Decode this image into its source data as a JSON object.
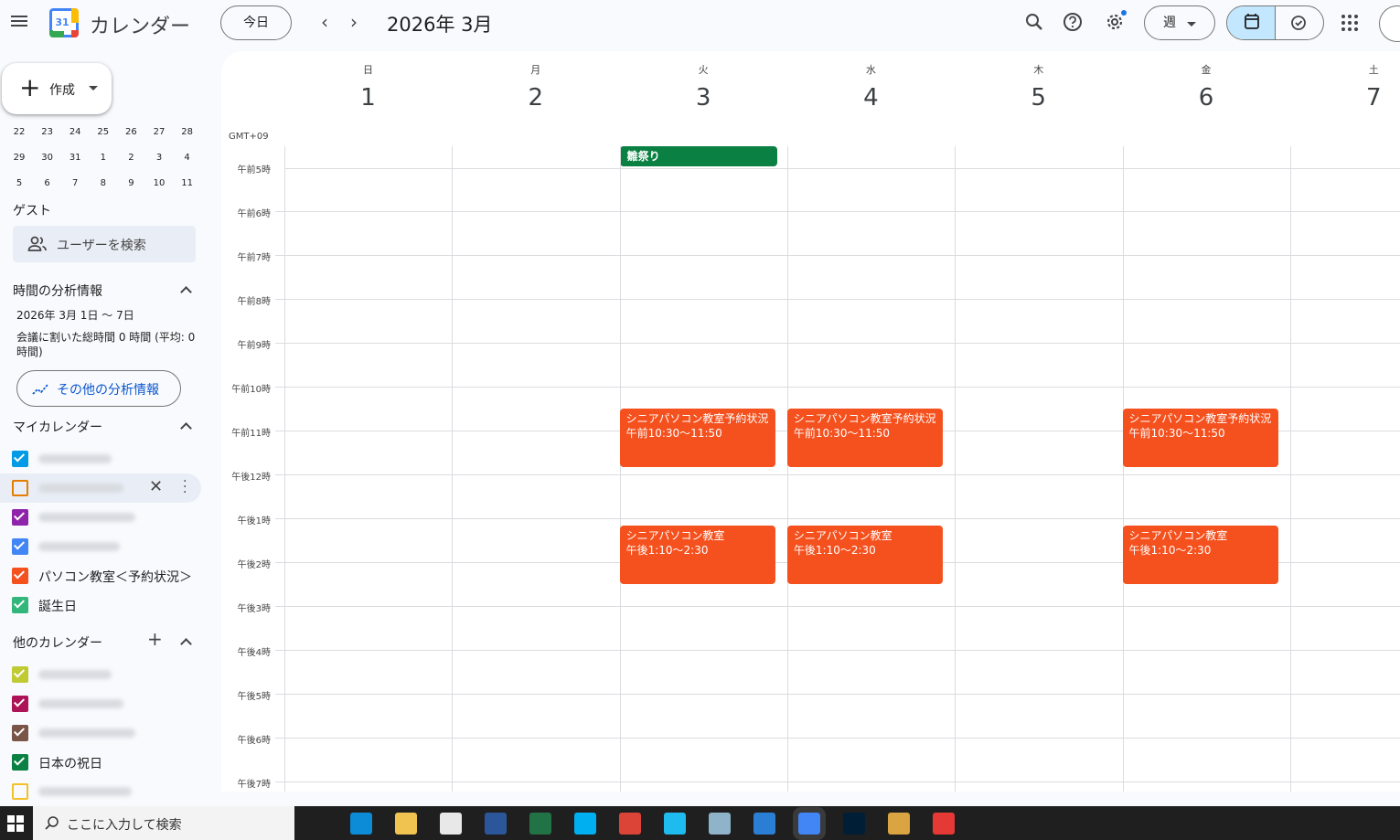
{
  "header": {
    "app_title": "カレンダー",
    "logo_day": "31",
    "today_label": "今日",
    "month_label": "2026年 3月",
    "view_label": "週"
  },
  "sidebar": {
    "create_label": "作成",
    "mini_calendar_rows": [
      [
        "22",
        "23",
        "24",
        "25",
        "26",
        "27",
        "28"
      ],
      [
        "29",
        "30",
        "31",
        "1",
        "2",
        "3",
        "4"
      ],
      [
        "5",
        "6",
        "7",
        "8",
        "9",
        "10",
        "11"
      ]
    ],
    "guests_heading": "ゲスト",
    "user_search_placeholder": "ユーザーを検索",
    "time_insights_heading": "時間の分析情報",
    "insights_range": "2026年 3月 1日 ～ 7日",
    "insights_line1": "会議に割いた総時間 0 時間 (平均: 0",
    "insights_line2": "時間)",
    "more_insights_label": "その他の分析情報",
    "my_calendars_heading": "マイカレンダー",
    "my_calendars": [
      {
        "name": "",
        "color": "#039be5",
        "checked": true
      },
      {
        "name": "",
        "color": "#e67c00",
        "checked": false
      },
      {
        "name": "",
        "color": "#8e24aa",
        "checked": true
      },
      {
        "name": "",
        "color": "#4285f4",
        "checked": true
      },
      {
        "name": "パソコン教室＜予約状況＞",
        "color": "#f4511e",
        "checked": true
      },
      {
        "name": "誕生日",
        "color": "#33b679",
        "checked": true
      }
    ],
    "other_calendars_heading": "他のカレンダー",
    "other_calendars": [
      {
        "name": "",
        "color": "#c0ca33",
        "checked": true
      },
      {
        "name": "",
        "color": "#ad1457",
        "checked": true
      },
      {
        "name": "",
        "color": "#795548",
        "checked": true
      },
      {
        "name": "日本の祝日",
        "color": "#0b8043",
        "checked": true
      },
      {
        "name": "",
        "color": "#f6bf26",
        "checked": false
      }
    ]
  },
  "week": {
    "timezone": "GMT+09",
    "days": [
      {
        "dow": "日",
        "num": "1"
      },
      {
        "dow": "月",
        "num": "2"
      },
      {
        "dow": "火",
        "num": "3"
      },
      {
        "dow": "水",
        "num": "4"
      },
      {
        "dow": "木",
        "num": "5"
      },
      {
        "dow": "金",
        "num": "6"
      },
      {
        "dow": "土",
        "num": "7"
      }
    ],
    "time_labels": [
      "午前5時",
      "午前6時",
      "午前7時",
      "午前8時",
      "午前9時",
      "午前10時",
      "午前11時",
      "午後12時",
      "午後1時",
      "午後2時",
      "午後3時",
      "午後4時",
      "午後5時",
      "午後6時",
      "午後7時"
    ],
    "all_day_event": {
      "title": "雛祭り",
      "day": 2,
      "color": "#0b8043"
    },
    "events": [
      {
        "title": "シニアパソコン教室予約状況",
        "time": "午前10:30～11:50",
        "day": 2,
        "start": 10.5,
        "end": 11.83,
        "color": "#f4511e"
      },
      {
        "title": "シニアパソコン教室予約状況",
        "time": "午前10:30～11:50",
        "day": 3,
        "start": 10.5,
        "end": 11.83,
        "color": "#f4511e"
      },
      {
        "title": "シニアパソコン教室予約状況",
        "time": "午前10:30～11:50",
        "day": 5,
        "start": 10.5,
        "end": 11.83,
        "color": "#f4511e"
      },
      {
        "title": "シニアパソコン教室",
        "time": "午後1:10～2:30",
        "day": 2,
        "start": 13.17,
        "end": 14.5,
        "color": "#f4511e"
      },
      {
        "title": "シニアパソコン教室",
        "time": "午後1:10～2:30",
        "day": 3,
        "start": 13.17,
        "end": 14.5,
        "color": "#f4511e"
      },
      {
        "title": "シニアパソコン教室",
        "time": "午後1:10～2:30",
        "day": 5,
        "start": 13.17,
        "end": 14.5,
        "color": "#f4511e"
      }
    ]
  },
  "taskbar": {
    "search_placeholder": "ここに入力して検索",
    "apps": [
      {
        "name": "task-view-icon",
        "color": "#1f1f1f"
      },
      {
        "name": "edge-icon",
        "color": "#0c8bd6"
      },
      {
        "name": "file-explorer-icon",
        "color": "#f0c24f"
      },
      {
        "name": "store-icon",
        "color": "#e8e8e8"
      },
      {
        "name": "word-icon",
        "color": "#2b579a"
      },
      {
        "name": "excel-icon",
        "color": "#217346"
      },
      {
        "name": "skype-icon",
        "color": "#00aff0"
      },
      {
        "name": "chrome-icon",
        "color": "#db4437"
      },
      {
        "name": "ie-icon",
        "color": "#1ebbee"
      },
      {
        "name": "notes-icon",
        "color": "#8fb3c9"
      },
      {
        "name": "pointer-app-icon",
        "color": "#2a7fd4"
      },
      {
        "name": "chrome-profile-icon",
        "color": "#4285f4"
      },
      {
        "name": "photoshop-icon",
        "color": "#001e36"
      },
      {
        "name": "paint-icon",
        "color": "#d9a441"
      },
      {
        "name": "pdf-app-icon",
        "color": "#e53935"
      }
    ]
  }
}
